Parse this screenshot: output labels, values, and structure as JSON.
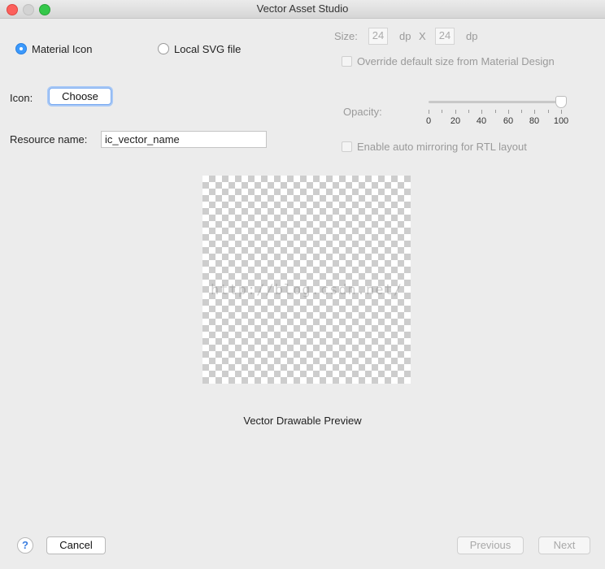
{
  "window": {
    "title": "Vector Asset Studio"
  },
  "source": {
    "material_icon_label": "Material Icon",
    "local_svg_label": "Local SVG file",
    "selected": "material_icon"
  },
  "icon": {
    "label": "Icon:",
    "choose_label": "Choose"
  },
  "resource": {
    "label": "Resource name:",
    "value": "ic_vector_name"
  },
  "size": {
    "label": "Size:",
    "width": "24",
    "height": "24",
    "unit": "dp",
    "separator": "X",
    "override_label": "Override default size from Material Design",
    "override_checked": false
  },
  "opacity": {
    "label": "Opacity:",
    "value": 100,
    "ticks": [
      "0",
      "20",
      "40",
      "60",
      "80",
      "100"
    ]
  },
  "rtl": {
    "label": "Enable auto mirroring for RTL layout",
    "checked": false
  },
  "preview": {
    "watermark": "http://blog.csdn.net/",
    "caption": "Vector Drawable Preview"
  },
  "footer": {
    "help_label": "?",
    "cancel_label": "Cancel",
    "previous_label": "Previous",
    "next_label": "Next"
  },
  "colors": {
    "accent": "#3b99fc",
    "close": "#fc605c",
    "zoom": "#34c84a"
  }
}
